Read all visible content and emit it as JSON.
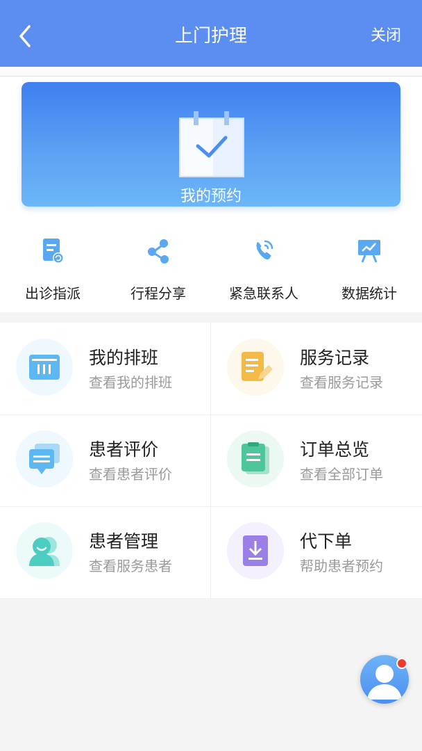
{
  "header": {
    "title": "上门护理",
    "close_label": "关闭"
  },
  "banner": {
    "label": "我的预约"
  },
  "quick_actions": [
    {
      "label": "出诊指派",
      "icon": "dispatch-doc-icon"
    },
    {
      "label": "行程分享",
      "icon": "share-icon"
    },
    {
      "label": "紧急联系人",
      "icon": "phone-call-icon"
    },
    {
      "label": "数据统计",
      "icon": "chart-board-icon"
    }
  ],
  "grid": [
    {
      "title": "我的排班",
      "subtitle": "查看我的排班",
      "icon": "schedule-icon",
      "color": "#5bb8f2",
      "bg": "#eef8fe"
    },
    {
      "title": "服务记录",
      "subtitle": "查看服务记录",
      "icon": "notes-edit-icon",
      "color": "#f5b947",
      "bg": "#fdf7ec"
    },
    {
      "title": "患者评价",
      "subtitle": "查看患者评价",
      "icon": "chat-bubbles-icon",
      "color": "#5bb8f2",
      "bg": "#eef8fe"
    },
    {
      "title": "订单总览",
      "subtitle": "查看全部订单",
      "icon": "clipboard-icon",
      "color": "#4cc79a",
      "bg": "#ecf9f3"
    },
    {
      "title": "患者管理",
      "subtitle": "查看服务患者",
      "icon": "patients-icon",
      "color": "#4ccdc2",
      "bg": "#ecfbf9"
    },
    {
      "title": "代下单",
      "subtitle": "帮助患者预约",
      "icon": "download-order-icon",
      "color": "#9b7ee6",
      "bg": "#f4f0fd"
    }
  ],
  "colors": {
    "header": "#5b8ef0",
    "accent": "#4a8ff0",
    "badge": "#f03a2e"
  }
}
